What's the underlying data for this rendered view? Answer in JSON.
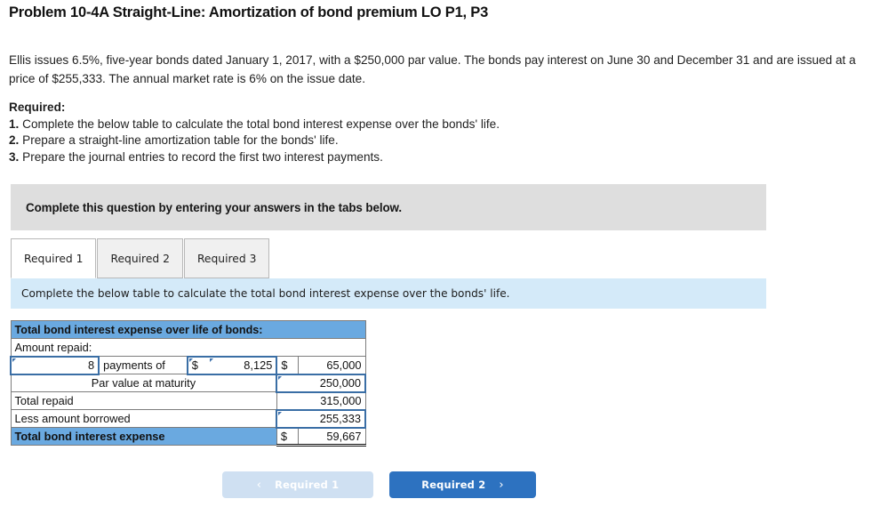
{
  "problem": {
    "title": "Problem 10-4A Straight-Line: Amortization of bond premium LO P1, P3",
    "description": "Ellis issues 6.5%, five-year bonds dated January 1, 2017, with a $250,000 par value. The bonds pay interest on June 30 and December 31 and are issued at a price of $255,333. The annual market rate is 6% on the issue date.",
    "required_heading": "Required:",
    "required_items": [
      {
        "num": "1.",
        "text": "Complete the below table to calculate the total bond interest expense over the bonds' life."
      },
      {
        "num": "2.",
        "text": "Prepare a straight-line amortization table for the bonds' life."
      },
      {
        "num": "3.",
        "text": "Prepare the journal entries to record the first two interest payments."
      }
    ]
  },
  "gray_banner": {
    "text": "Complete this question by entering your answers in the tabs below."
  },
  "tabs": [
    {
      "label": "Required 1",
      "active": true
    },
    {
      "label": "Required 2",
      "active": false
    },
    {
      "label": "Required 3",
      "active": false
    }
  ],
  "blue_banner": {
    "text": "Complete the below table to calculate the total bond interest expense over the bonds' life."
  },
  "answer_table": {
    "header": "Total bond interest expense over life of bonds:",
    "subheader": "Amount repaid:",
    "rows": {
      "payments": {
        "count": "8",
        "label": "payments of",
        "unit_symbol": "$",
        "unit_amount": "8,125",
        "total_symbol": "$",
        "total_amount": "65,000"
      },
      "par_value": {
        "label": "Par value at maturity",
        "amount": "250,000"
      },
      "total_repaid": {
        "label": "Total repaid",
        "amount": "315,000"
      },
      "less_borrowed": {
        "label": "Less amount borrowed",
        "amount": "255,333"
      },
      "total_expense": {
        "label": "Total bond interest expense",
        "symbol": "$",
        "amount": "59,667"
      }
    }
  },
  "navigation": {
    "prev_label": "Required 1",
    "prev_chevron": "‹",
    "next_label": "Required 2",
    "next_chevron": "›"
  },
  "colors": {
    "accent_blue": "#2d72c0",
    "table_header_blue": "#6aa9e0",
    "banner_gray": "#dedede",
    "banner_light_blue": "#d4eaf9",
    "input_border_blue": "#3a6ea5"
  }
}
